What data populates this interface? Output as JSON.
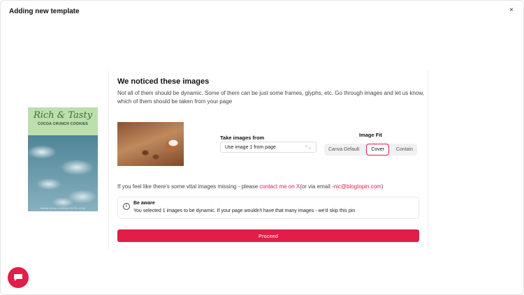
{
  "modal": {
    "title": "Adding new template",
    "close_icon": "×"
  },
  "preview": {
    "title_script": "Rich & Tasty",
    "subtitle": "COCOA CRUNCH COOKIES",
    "footer": "WWW.REALLYGREATSITE.COM"
  },
  "panel": {
    "heading": "We noticed these images",
    "description": "Not all of them should be dynamic. Some of them can be just some frames, glyphs, etc. Go through images and let us know, which of them should be taken from your page",
    "take_images_label": "Take images from",
    "take_images_value": "Use image 1 from page",
    "chevron": "⌃⌄",
    "image_fit_label": "Image Fit",
    "fit_options": [
      "Canva Default",
      "Cover",
      "Contain"
    ],
    "fit_selected": "Cover",
    "missing_text": "If you feel like there's some vital images missing - please ",
    "contact_link": "contact me on X",
    "missing_mid": "(or via email -",
    "email_link": "nic@blogtopin.com",
    "missing_end": ")",
    "alert_icon": "i",
    "alert_title": "Be aware",
    "alert_text": "You selected 1 images to be dynamic. If your page wouldn't have that many images - we'd skip this pin",
    "proceed_label": "Proceed"
  },
  "colors": {
    "accent": "#e11d48"
  },
  "icons": {
    "close": "close-icon",
    "info": "info-icon",
    "chat": "chat-icon",
    "chevron": "chevron-updown-icon"
  }
}
